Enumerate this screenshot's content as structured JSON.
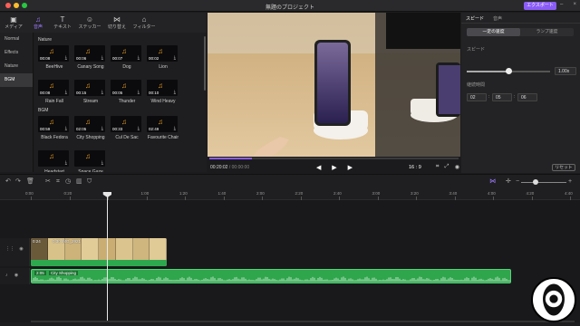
{
  "window": {
    "title": "無題のプロジェクト",
    "export_label": "エクスポート"
  },
  "media_tabs": [
    {
      "label": "メディア",
      "icon": "media-icon"
    },
    {
      "label": "音声",
      "icon": "music-note-icon",
      "active": true
    },
    {
      "label": "テキスト",
      "icon": "text-icon"
    },
    {
      "label": "ステッカー",
      "icon": "sticker-icon"
    },
    {
      "label": "切り替え",
      "icon": "transition-icon"
    },
    {
      "label": "フィルター",
      "icon": "filter-icon"
    }
  ],
  "categories": [
    {
      "label": "Normal"
    },
    {
      "label": "Effects"
    },
    {
      "label": "Nature"
    },
    {
      "label": "BGM",
      "active": true
    }
  ],
  "library": {
    "nature": {
      "title": "Nature",
      "items": [
        {
          "duration": "00:08",
          "name": "BeeHive"
        },
        {
          "duration": "00:06",
          "name": "Canary Song"
        },
        {
          "duration": "00:07",
          "name": "Dog"
        },
        {
          "duration": "00:02",
          "name": "Lion"
        },
        {
          "duration": "00:08",
          "name": "Rain Fall"
        },
        {
          "duration": "00:15",
          "name": "Stream"
        },
        {
          "duration": "00:05",
          "name": "Thunder"
        },
        {
          "duration": "00:10",
          "name": "Wind Heavy"
        }
      ]
    },
    "bgm": {
      "title": "BGM",
      "items": [
        {
          "duration": "00:59",
          "name": "Black Fedora"
        },
        {
          "duration": "02:05",
          "name": "City Shopping"
        },
        {
          "duration": "00:33",
          "name": "Cul De Sac"
        },
        {
          "duration": "02:49",
          "name": "Favourite Chair"
        },
        {
          "duration": "",
          "name": "Headstart"
        },
        {
          "duration": "",
          "name": "Space Gaze"
        }
      ]
    }
  },
  "preview": {
    "current_time": "00:20:02",
    "total_time": "/ 00:00:00",
    "aspect_ratio": "16 : 9",
    "progress": 0.17
  },
  "properties": {
    "tabs": [
      "スピード",
      "音声"
    ],
    "speed_modes": [
      "一定の速度",
      "ランプ速度"
    ],
    "speed_label": "スピード",
    "speed_value": "1.00x",
    "speed_slider": 0.5,
    "duration_label": "継続時間",
    "duration": {
      "h": "02",
      "m": "05",
      "s": "06"
    },
    "reset_label": "リセット"
  },
  "timeline": {
    "ruler": [
      "0:00",
      "0:20",
      "0:40",
      "1:00",
      "1:20",
      "1:40",
      "2:00",
      "2:20",
      "2:40",
      "3:00",
      "3:20",
      "3:40",
      "4:00",
      "4:20",
      "4:40"
    ],
    "video_clip": {
      "duration": "0:24",
      "name": "0:30 IMG_2921"
    },
    "audio_clip": {
      "duration": "2:05",
      "name": "City Shopping"
    }
  },
  "colors": {
    "accent": "#8a5cf6",
    "audio_track": "#2fa54c",
    "video_clip": "#caa24a"
  }
}
